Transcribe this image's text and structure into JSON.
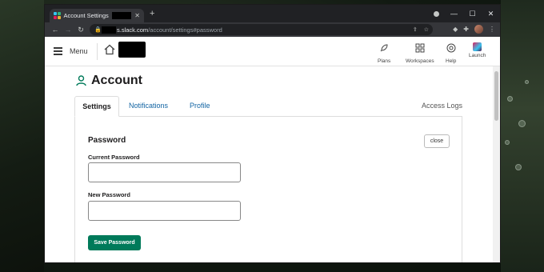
{
  "browser": {
    "tab_title": "Account Settings",
    "url_host": "s.slack.com",
    "url_path": "/account/settings#password",
    "new_tab": "+",
    "controls": {
      "minimize": "—",
      "maximize": "☐",
      "close": "✕"
    }
  },
  "header": {
    "menu_label": "Menu",
    "items": [
      {
        "label": "Plans",
        "icon": "rocket-icon"
      },
      {
        "label": "Workspaces",
        "icon": "grid-icon"
      },
      {
        "label": "Help",
        "icon": "lifebuoy-icon"
      },
      {
        "label": "Launch",
        "icon": "slack-logo-icon"
      }
    ]
  },
  "page": {
    "title": "Account",
    "tabs": [
      {
        "label": "Settings",
        "active": true
      },
      {
        "label": "Notifications",
        "active": false
      },
      {
        "label": "Profile",
        "active": false
      }
    ],
    "access_logs_label": "Access Logs"
  },
  "password_form": {
    "heading": "Password",
    "close_label": "close",
    "current_label": "Current Password",
    "current_value": "",
    "new_label": "New Password",
    "new_value": "",
    "save_label": "Save Password"
  },
  "colors": {
    "primary_button": "#007a5a",
    "link": "#1264a3"
  }
}
